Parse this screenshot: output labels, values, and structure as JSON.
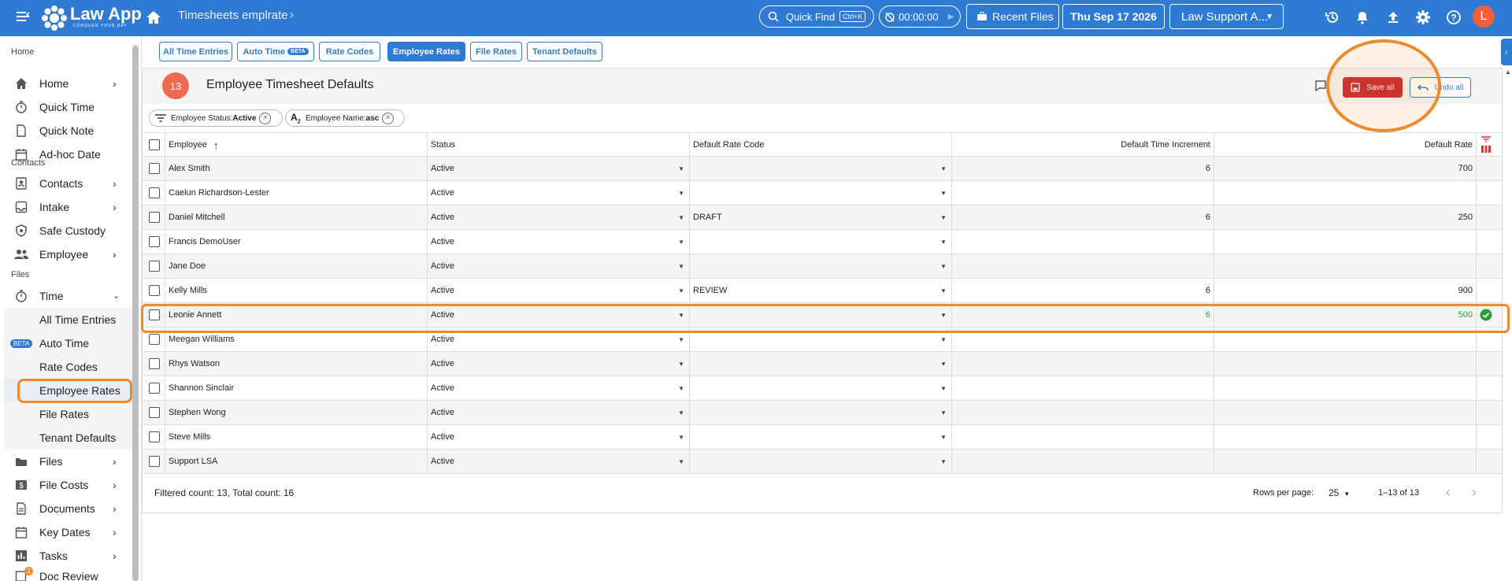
{
  "topbar": {
    "logo_text": "Law App",
    "logo_tagline": "CONQUER YOUR DAY",
    "breadcrumb": "Timesheets emplrate",
    "quick_find": "Quick Find",
    "quick_find_shortcut": "Ctrl+K",
    "timer": "00:00:00",
    "recent_files": "Recent Files",
    "date": "Thu Sep 17 2026",
    "firm": "Law Support A...",
    "avatar_letter": "L"
  },
  "sidebar": {
    "sections": {
      "home": "Home",
      "contacts": "Contacts",
      "files": "Files"
    },
    "items": [
      {
        "label": "Home"
      },
      {
        "label": "Quick Time"
      },
      {
        "label": "Quick Note"
      },
      {
        "label": "Ad-hoc Date"
      },
      {
        "label": "Contacts"
      },
      {
        "label": "Intake"
      },
      {
        "label": "Safe Custody"
      },
      {
        "label": "Employee"
      },
      {
        "label": "Time"
      },
      {
        "label": "All Time Entries"
      },
      {
        "label": "Auto Time"
      },
      {
        "label": "Rate Codes"
      },
      {
        "label": "Employee Rates"
      },
      {
        "label": "File Rates"
      },
      {
        "label": "Tenant Defaults"
      },
      {
        "label": "Files"
      },
      {
        "label": "File Costs"
      },
      {
        "label": "Documents"
      },
      {
        "label": "Key Dates"
      },
      {
        "label": "Tasks"
      },
      {
        "label": "Doc Review"
      }
    ],
    "beta_label": "BETA",
    "doc_review_badge": "2"
  },
  "tabs": [
    "All Time Entries",
    "Auto Time",
    "Rate Codes",
    "Employee Rates",
    "File Rates",
    "Tenant Defaults"
  ],
  "tab_beta": "BETA",
  "panel": {
    "count": "13",
    "title": "Employee Timesheet Defaults",
    "save_all": "Save all",
    "undo_all": "Undo all"
  },
  "filters": [
    {
      "label": "Employee Status:",
      "value": "Active"
    },
    {
      "label": "Employee Name:",
      "value": "asc"
    }
  ],
  "columns": [
    "Employee",
    "Status",
    "Default Rate Code",
    "Default Time Increment",
    "Default Rate"
  ],
  "rows": [
    {
      "employee": "Alex Smith",
      "status": "Active",
      "rate_code": "",
      "increment": "6",
      "rate": "700"
    },
    {
      "employee": "Caelun Richardson-Lester",
      "status": "Active",
      "rate_code": "",
      "increment": "",
      "rate": ""
    },
    {
      "employee": "Daniel Mitchell",
      "status": "Active",
      "rate_code": "DRAFT",
      "increment": "6",
      "rate": "250"
    },
    {
      "employee": "Francis DemoUser",
      "status": "Active",
      "rate_code": "",
      "increment": "",
      "rate": ""
    },
    {
      "employee": "Jane Doe",
      "status": "Active",
      "rate_code": "",
      "increment": "",
      "rate": ""
    },
    {
      "employee": "Kelly Mills",
      "status": "Active",
      "rate_code": "REVIEW",
      "increment": "6",
      "rate": "900"
    },
    {
      "employee": "Leonie Annett",
      "status": "Active",
      "rate_code": "",
      "increment": "6",
      "rate": "500",
      "saved": true
    },
    {
      "employee": "Meegan Williams",
      "status": "Active",
      "rate_code": "",
      "increment": "",
      "rate": ""
    },
    {
      "employee": "Rhys Watson",
      "status": "Active",
      "rate_code": "",
      "increment": "",
      "rate": ""
    },
    {
      "employee": "Shannon Sinclair",
      "status": "Active",
      "rate_code": "",
      "increment": "",
      "rate": ""
    },
    {
      "employee": "Stephen Wong",
      "status": "Active",
      "rate_code": "",
      "increment": "",
      "rate": ""
    },
    {
      "employee": "Steve Mills",
      "status": "Active",
      "rate_code": "",
      "increment": "",
      "rate": ""
    },
    {
      "employee": "Support LSA",
      "status": "Active",
      "rate_code": "",
      "increment": "",
      "rate": ""
    }
  ],
  "footer": {
    "counts": "Filtered count: 13, Total count: 16",
    "rows_per_page_label": "Rows per page:",
    "rows_per_page": "25",
    "range": "1–13 of 13"
  },
  "colors": {
    "brand": "#2f7bd3",
    "danger": "#c5282d",
    "highlight": "#ef8a2c",
    "success": "#2e9b3a"
  }
}
